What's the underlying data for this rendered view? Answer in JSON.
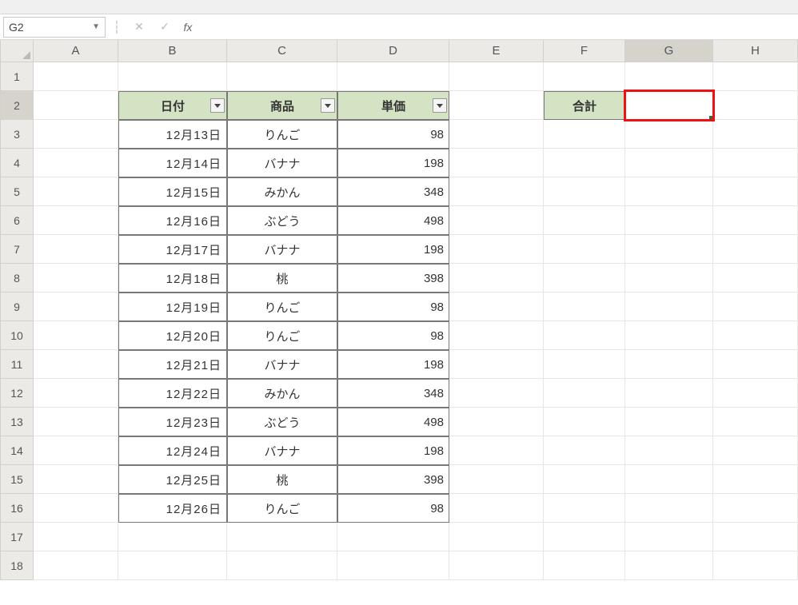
{
  "name_box": {
    "value": "G2"
  },
  "formula_bar": {
    "value": ""
  },
  "columns": [
    "A",
    "B",
    "C",
    "D",
    "E",
    "F",
    "G",
    "H"
  ],
  "row_count": 18,
  "active_col": "G",
  "active_row": 2,
  "table": {
    "headers": {
      "date": "日付",
      "item": "商品",
      "price": "単価"
    },
    "rows": [
      {
        "date": "12月13日",
        "item": "りんご",
        "price": "98"
      },
      {
        "date": "12月14日",
        "item": "バナナ",
        "price": "198"
      },
      {
        "date": "12月15日",
        "item": "みかん",
        "price": "348"
      },
      {
        "date": "12月16日",
        "item": "ぶどう",
        "price": "498"
      },
      {
        "date": "12月17日",
        "item": "バナナ",
        "price": "198"
      },
      {
        "date": "12月18日",
        "item": "桃",
        "price": "398"
      },
      {
        "date": "12月19日",
        "item": "りんご",
        "price": "98"
      },
      {
        "date": "12月20日",
        "item": "りんご",
        "price": "98"
      },
      {
        "date": "12月21日",
        "item": "バナナ",
        "price": "198"
      },
      {
        "date": "12月22日",
        "item": "みかん",
        "price": "348"
      },
      {
        "date": "12月23日",
        "item": "ぶどう",
        "price": "498"
      },
      {
        "date": "12月24日",
        "item": "バナナ",
        "price": "198"
      },
      {
        "date": "12月25日",
        "item": "桃",
        "price": "398"
      },
      {
        "date": "12月26日",
        "item": "りんご",
        "price": "98"
      }
    ]
  },
  "sum_label": "合計",
  "chart_data": {
    "type": "table",
    "columns": [
      "日付",
      "商品",
      "単価"
    ],
    "rows": [
      [
        "12月13日",
        "りんご",
        98
      ],
      [
        "12月14日",
        "バナナ",
        198
      ],
      [
        "12月15日",
        "みかん",
        348
      ],
      [
        "12月16日",
        "ぶどう",
        498
      ],
      [
        "12月17日",
        "バナナ",
        198
      ],
      [
        "12月18日",
        "桃",
        398
      ],
      [
        "12月19日",
        "りんご",
        98
      ],
      [
        "12月20日",
        "りんご",
        98
      ],
      [
        "12月21日",
        "バナナ",
        198
      ],
      [
        "12月22日",
        "みかん",
        348
      ],
      [
        "12月23日",
        "ぶどう",
        498
      ],
      [
        "12月24日",
        "バナナ",
        198
      ],
      [
        "12月25日",
        "桃",
        398
      ],
      [
        "12月26日",
        "りんご",
        98
      ]
    ],
    "side_label": "合計"
  }
}
